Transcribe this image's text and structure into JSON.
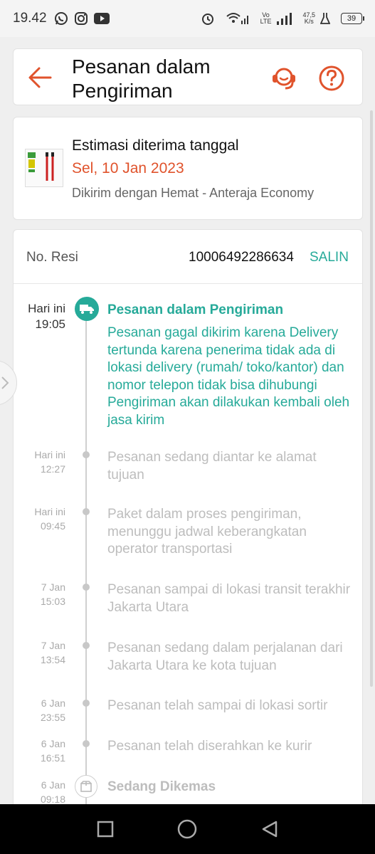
{
  "status_bar": {
    "time": "19.42",
    "net_speed_value": "47,5",
    "net_speed_unit": "K/s",
    "battery": "39",
    "network_label": "Vo\nLTE"
  },
  "header": {
    "title": "Pesanan dalam Pengiriman"
  },
  "estimate": {
    "label": "Estimasi diterima tanggal",
    "date": "Sel, 10 Jan 2023",
    "shipping": "Dikirim dengan Hemat - Anteraja Economy"
  },
  "tracking": {
    "resi_label": "No. Resi",
    "resi_number": "10006492286634",
    "copy_label": "SALIN",
    "current": {
      "day": "Hari ini",
      "time": "19:05",
      "status": "Pesanan dalam Pengiriman",
      "description": "Pesanan gagal dikirim karena Delivery tertunda karena penerima tidak ada di lokasi delivery (rumah/ toko/kantor) dan nomor telepon tidak bisa dihubungi Pengiriman akan dilakukan kembali oleh jasa kirim"
    },
    "events": [
      {
        "day": "Hari ini",
        "time": "12:27",
        "text": "Pesanan sedang diantar ke alamat tujuan"
      },
      {
        "day": "Hari ini",
        "time": "09:45",
        "text": "Paket dalam proses pengiriman, menunggu jadwal keberangkatan operator transportasi"
      },
      {
        "day": "7 Jan",
        "time": "15:03",
        "text": "Pesanan sampai di lokasi transit terakhir Jakarta Utara"
      },
      {
        "day": "7 Jan",
        "time": "13:54",
        "text": "Pesanan sedang dalam perjalanan dari Jakarta Utara ke kota tujuan"
      },
      {
        "day": "6 Jan",
        "time": "23:55",
        "text": "Pesanan telah sampai di lokasi sortir"
      },
      {
        "day": "6 Jan",
        "time": "16:51",
        "text": "Pesanan telah diserahkan ke kurir"
      }
    ],
    "packing": {
      "day": "6 Jan",
      "time": "09:18",
      "status": "Sedang Dikemas"
    }
  },
  "colors": {
    "accent": "#e0532c",
    "teal": "#26aa99"
  }
}
